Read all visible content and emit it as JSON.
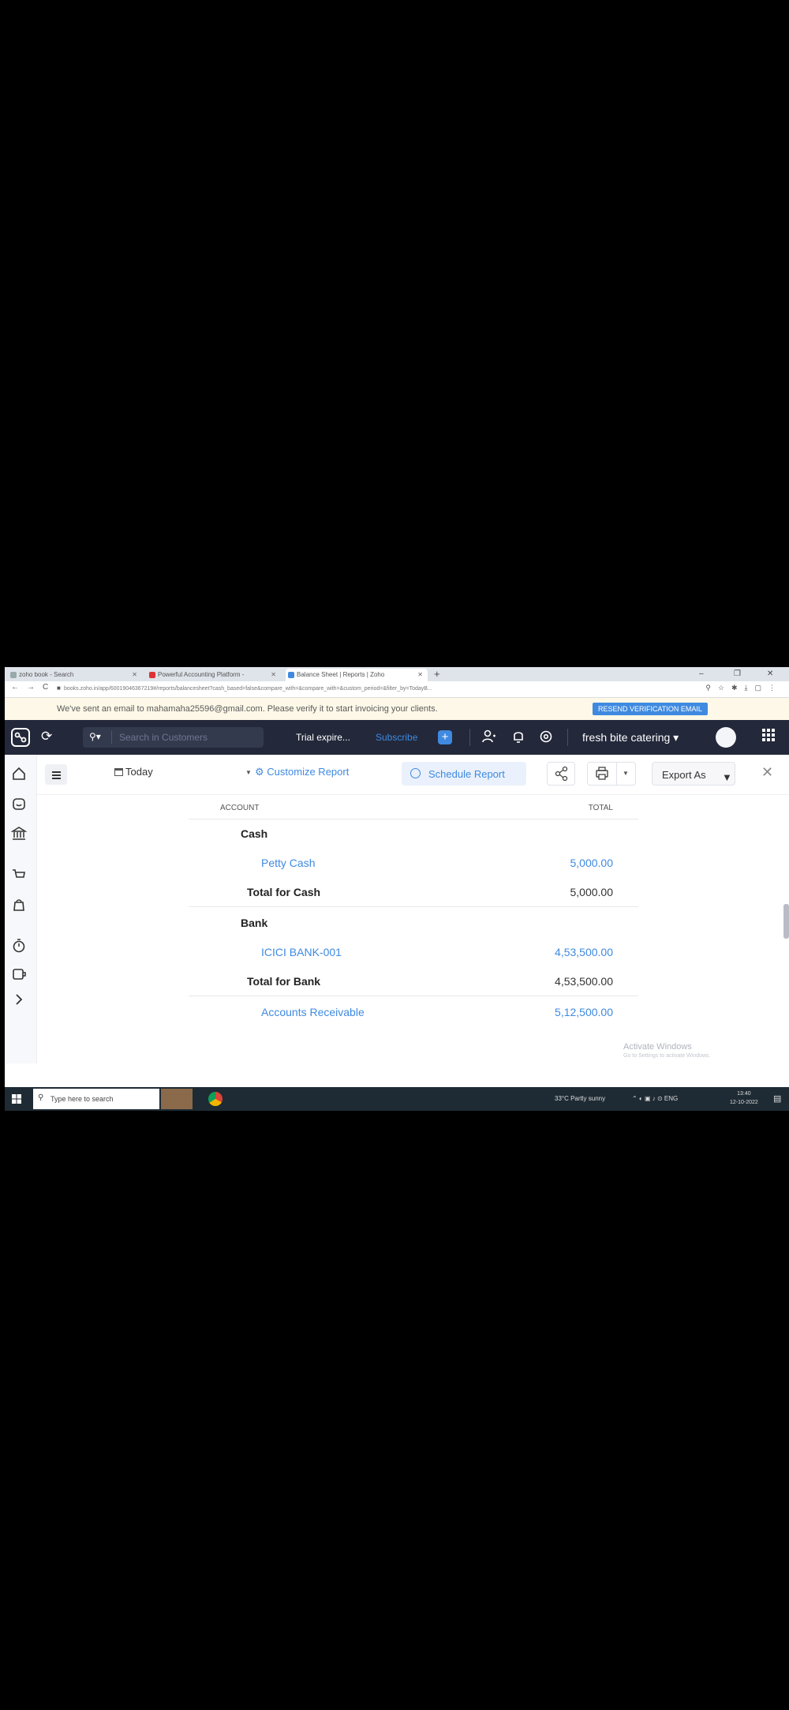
{
  "browser": {
    "tabs": [
      {
        "label": "zoho book - Search"
      },
      {
        "label": "Powerful Accounting Platform - "
      },
      {
        "label": "Balance Sheet | Reports | Zoho"
      }
    ],
    "url": "books.zoho.in/app/60019046367219#/reports/balancesheet?cash_based=false&compare_with=&compare_with=&custom_period=&filter_by=TodayB..."
  },
  "banner": {
    "message": "We've sent an email to mahamaha25596@gmail.com. Please verify it to start invoicing your clients.",
    "button": "RESEND VERIFICATION EMAIL"
  },
  "topbar": {
    "search_placeholder": "Search in Customers",
    "trial": "Trial expire...",
    "subscribe": "Subscribe",
    "plus": "+",
    "org": "fresh bite catering"
  },
  "toolbar": {
    "date_filter": "Today",
    "customize": "Customize Report",
    "schedule": "Schedule Report",
    "export": "Export As"
  },
  "report": {
    "col_account": "ACCOUNT",
    "col_total": "TOTAL",
    "rows": [
      {
        "type": "section",
        "name": "Cash",
        "value": ""
      },
      {
        "type": "item",
        "name": "Petty Cash",
        "value": "5,000.00"
      },
      {
        "type": "total",
        "name": "Total for Cash",
        "value": "5,000.00"
      },
      {
        "type": "section",
        "name": "Bank",
        "value": ""
      },
      {
        "type": "item",
        "name": "ICICI BANK-001",
        "value": "4,53,500.00"
      },
      {
        "type": "total",
        "name": "Total for Bank",
        "value": "4,53,500.00"
      },
      {
        "type": "item",
        "name": "Accounts Receivable",
        "value": "5,12,500.00"
      }
    ]
  },
  "watermark": {
    "title": "Activate Windows",
    "subtitle": "Go to Settings to activate Windows."
  },
  "taskbar": {
    "search_placeholder": "Type here to search",
    "weather": "33°C Partly sunny",
    "lang": "ENG",
    "time": "13:40",
    "date": "12-10-2022"
  },
  "colors": {
    "accent": "#3f8ae0",
    "topbar": "#23283a",
    "banner": "#fdf8e8"
  }
}
